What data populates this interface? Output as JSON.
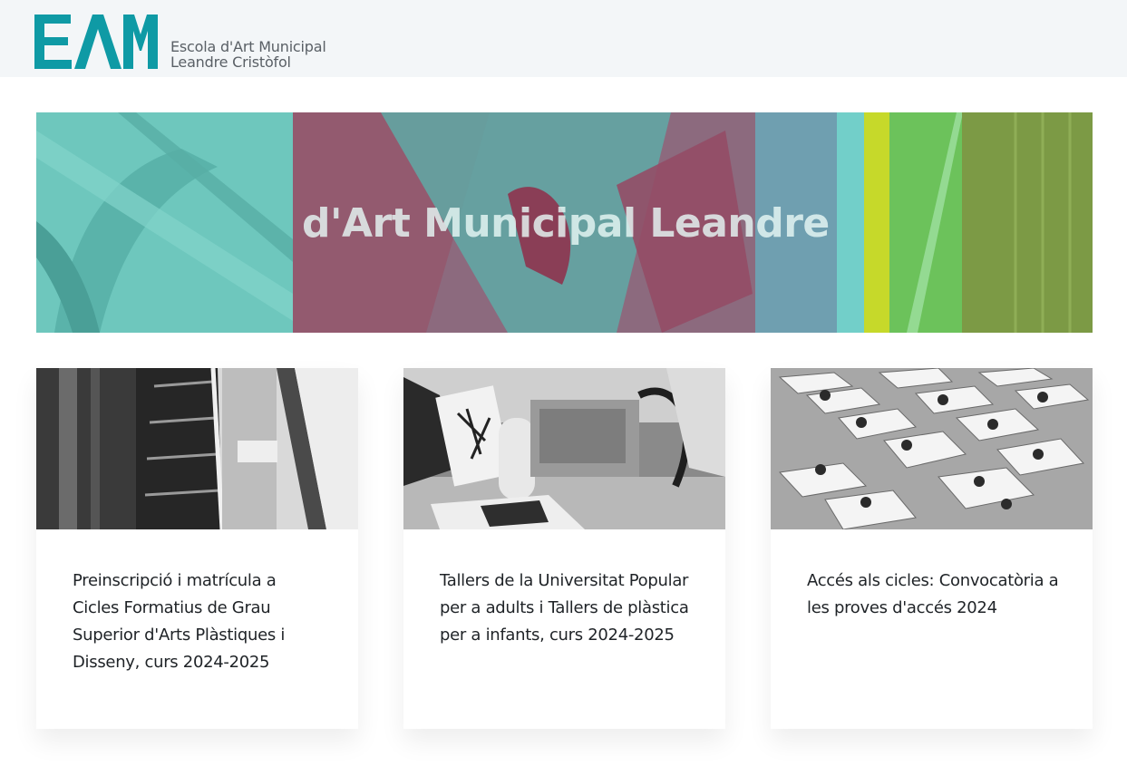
{
  "header": {
    "logo_mark": "EAM",
    "logo_line1": "Escola d'Art Municipal",
    "logo_line2": "Leandre Cristòfol"
  },
  "banner": {
    "text": "d'Art Municipal Leandre Cr"
  },
  "cards": [
    {
      "title": "Preinscripció i matrícula a Cicles Formatius de Grau Superior d'Arts Plàstiques i Disseny, curs 2024-2025"
    },
    {
      "title": "Tallers de la Universitat Popular per a adults i Tallers de plàstica per a infants, curs 2024-2025"
    },
    {
      "title": "Accés als cicles: Convocatòria a les proves d'accés 2024"
    }
  ],
  "colors": {
    "brand_teal": "#0f9aa5",
    "header_bg": "#f3f6f8",
    "logo_text": "#5a6066"
  }
}
